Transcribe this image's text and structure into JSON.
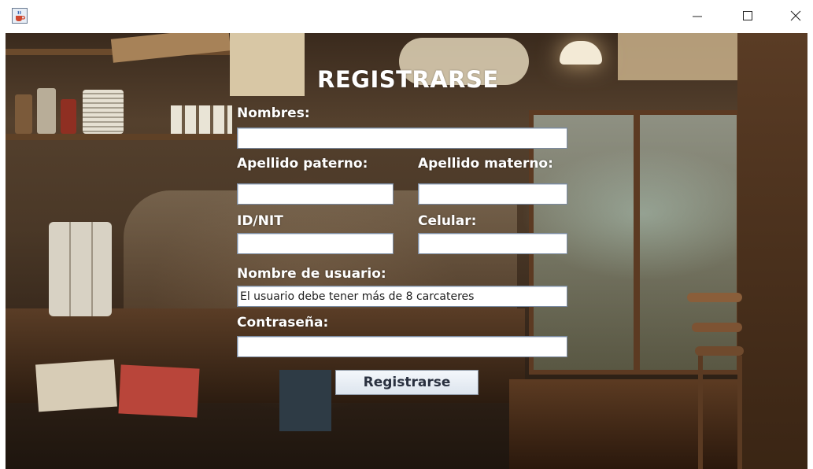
{
  "window": {
    "app_icon": "java-cup-icon",
    "controls": [
      "minimize-icon",
      "maximize-icon",
      "close-icon"
    ]
  },
  "form": {
    "title": "REGISTRARSE",
    "nombres_label": "Nombres:",
    "nombres_value": "",
    "apellido_paterno_label": "Apellido paterno:",
    "apellido_paterno_value": "",
    "apellido_materno_label": "Apellido materno:",
    "apellido_materno_value": "",
    "id_nit_label": "ID/NIT",
    "id_nit_value": "",
    "celular_label": "Celular:",
    "celular_value": "",
    "usuario_label": "Nombre de usuario:",
    "usuario_value": "El usuario debe tener más de 8 carcateres",
    "contrasena_label": "Contraseña:",
    "contrasena_value": "",
    "submit_label": "Registrarse"
  },
  "colors": {
    "label_text": "#ffffff",
    "field_border": "#7a8aa0",
    "button_text": "#2a3140"
  }
}
